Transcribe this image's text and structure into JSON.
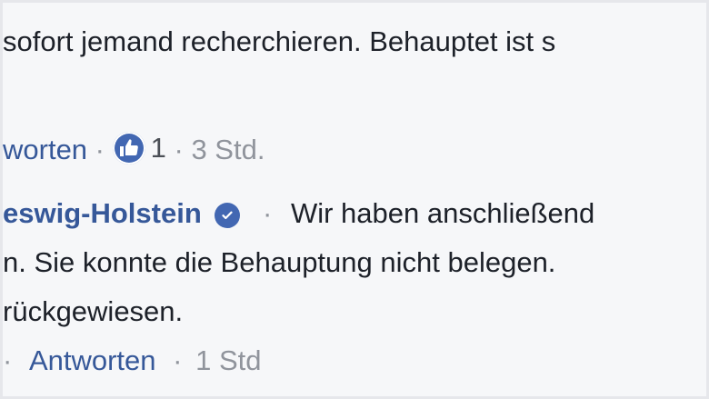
{
  "comment1": {
    "text": "sofort jemand recherchieren. Behauptet ist s",
    "actions": {
      "reply": "worten",
      "separator1": "·",
      "like_count": "1",
      "separator2": "·",
      "time": "3 Std."
    },
    "icons": {
      "like": "like-thumbs-up-icon"
    }
  },
  "comment2": {
    "author": "eswig-Holstein",
    "separator": "·",
    "text_line1": "Wir haben anschließend",
    "text_line2": "n. Sie konnte die Behauptung nicht belegen.",
    "text_line3": "rückgewiesen.",
    "icons": {
      "verified": "verified-badge-icon"
    },
    "actions": {
      "separator_lead": "·",
      "reply": "Antworten",
      "separator": "·",
      "time": "1 Std"
    }
  },
  "colors": {
    "link": "#365899",
    "meta": "#90949c",
    "accent": "#4267b2",
    "background": "#f6f7f9"
  }
}
